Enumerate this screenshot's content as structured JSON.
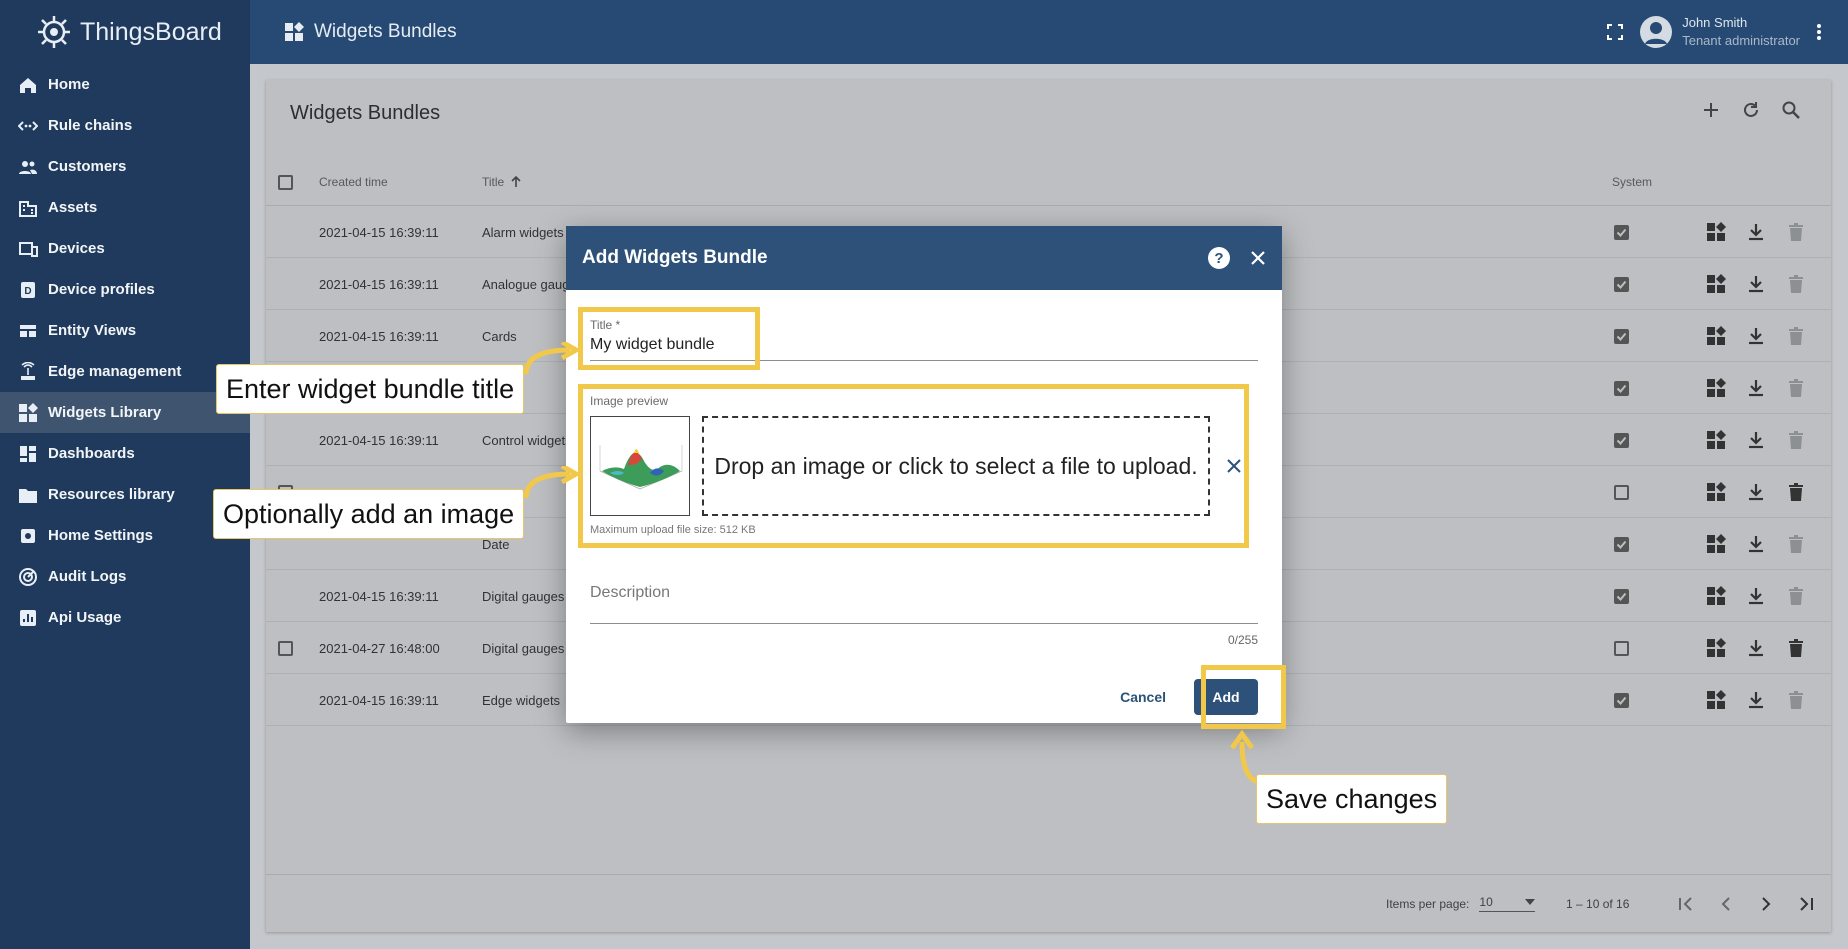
{
  "app": {
    "name": "ThingsBoard"
  },
  "sidebar": {
    "items": [
      {
        "label": "Home",
        "icon": "home-icon"
      },
      {
        "label": "Rule chains",
        "icon": "rule-chain-icon"
      },
      {
        "label": "Customers",
        "icon": "customers-icon"
      },
      {
        "label": "Assets",
        "icon": "assets-icon"
      },
      {
        "label": "Devices",
        "icon": "devices-icon"
      },
      {
        "label": "Device profiles",
        "icon": "device-profile-icon"
      },
      {
        "label": "Entity Views",
        "icon": "entity-views-icon"
      },
      {
        "label": "Edge management",
        "icon": "edge-icon"
      },
      {
        "label": "Widgets Library",
        "icon": "widgets-icon",
        "active": true
      },
      {
        "label": "Dashboards",
        "icon": "dashboards-icon"
      },
      {
        "label": "Resources library",
        "icon": "folder-icon"
      },
      {
        "label": "Home Settings",
        "icon": "settings-icon"
      },
      {
        "label": "Audit Logs",
        "icon": "audit-icon"
      },
      {
        "label": "Api Usage",
        "icon": "api-usage-icon"
      }
    ]
  },
  "topbar": {
    "title": "Widgets Bundles",
    "user_name": "John Smith",
    "user_role": "Tenant administrator"
  },
  "card": {
    "title": "Widgets Bundles",
    "columns": {
      "created": "Created time",
      "title": "Title",
      "system": "System"
    },
    "rows": [
      {
        "created": "2021-04-15 16:39:11",
        "title": "Alarm widgets",
        "system": true,
        "selectable": false
      },
      {
        "created": "2021-04-15 16:39:11",
        "title": "Analogue gauges",
        "system": true,
        "selectable": false
      },
      {
        "created": "2021-04-15 16:39:11",
        "title": "Cards",
        "system": true,
        "selectable": false
      },
      {
        "created": "",
        "title": "",
        "system": true,
        "selectable": false
      },
      {
        "created": "2021-04-15 16:39:11",
        "title": "Control widgets",
        "system": true,
        "selectable": false
      },
      {
        "created": "",
        "title": "",
        "system": false,
        "selectable": true
      },
      {
        "created": "",
        "title": "Date",
        "system": true,
        "selectable": false
      },
      {
        "created": "2021-04-15 16:39:11",
        "title": "Digital gauges",
        "system": true,
        "selectable": false
      },
      {
        "created": "2021-04-27 16:48:00",
        "title": "Digital gauges",
        "system": false,
        "selectable": true
      },
      {
        "created": "2021-04-15 16:39:11",
        "title": "Edge widgets",
        "system": true,
        "selectable": false
      }
    ],
    "footer": {
      "items_per_page_label": "Items per page:",
      "items_per_page": "10",
      "range": "1 – 10 of 16"
    }
  },
  "dialog": {
    "title": "Add Widgets Bundle",
    "title_field_label": "Title *",
    "title_field_value": "My widget bundle",
    "image_label": "Image preview",
    "drop_text": "Drop an image or click to select a file to upload.",
    "max_size_hint": "Maximum upload file size: 512 KB",
    "description_placeholder": "Description",
    "description_count": "0/255",
    "cancel_label": "Cancel",
    "add_label": "Add"
  },
  "annotations": {
    "title_hint": "Enter widget bundle title",
    "image_hint": "Optionally add an image",
    "save_hint": "Save changes",
    "highlight_color": "#f2c84b"
  }
}
